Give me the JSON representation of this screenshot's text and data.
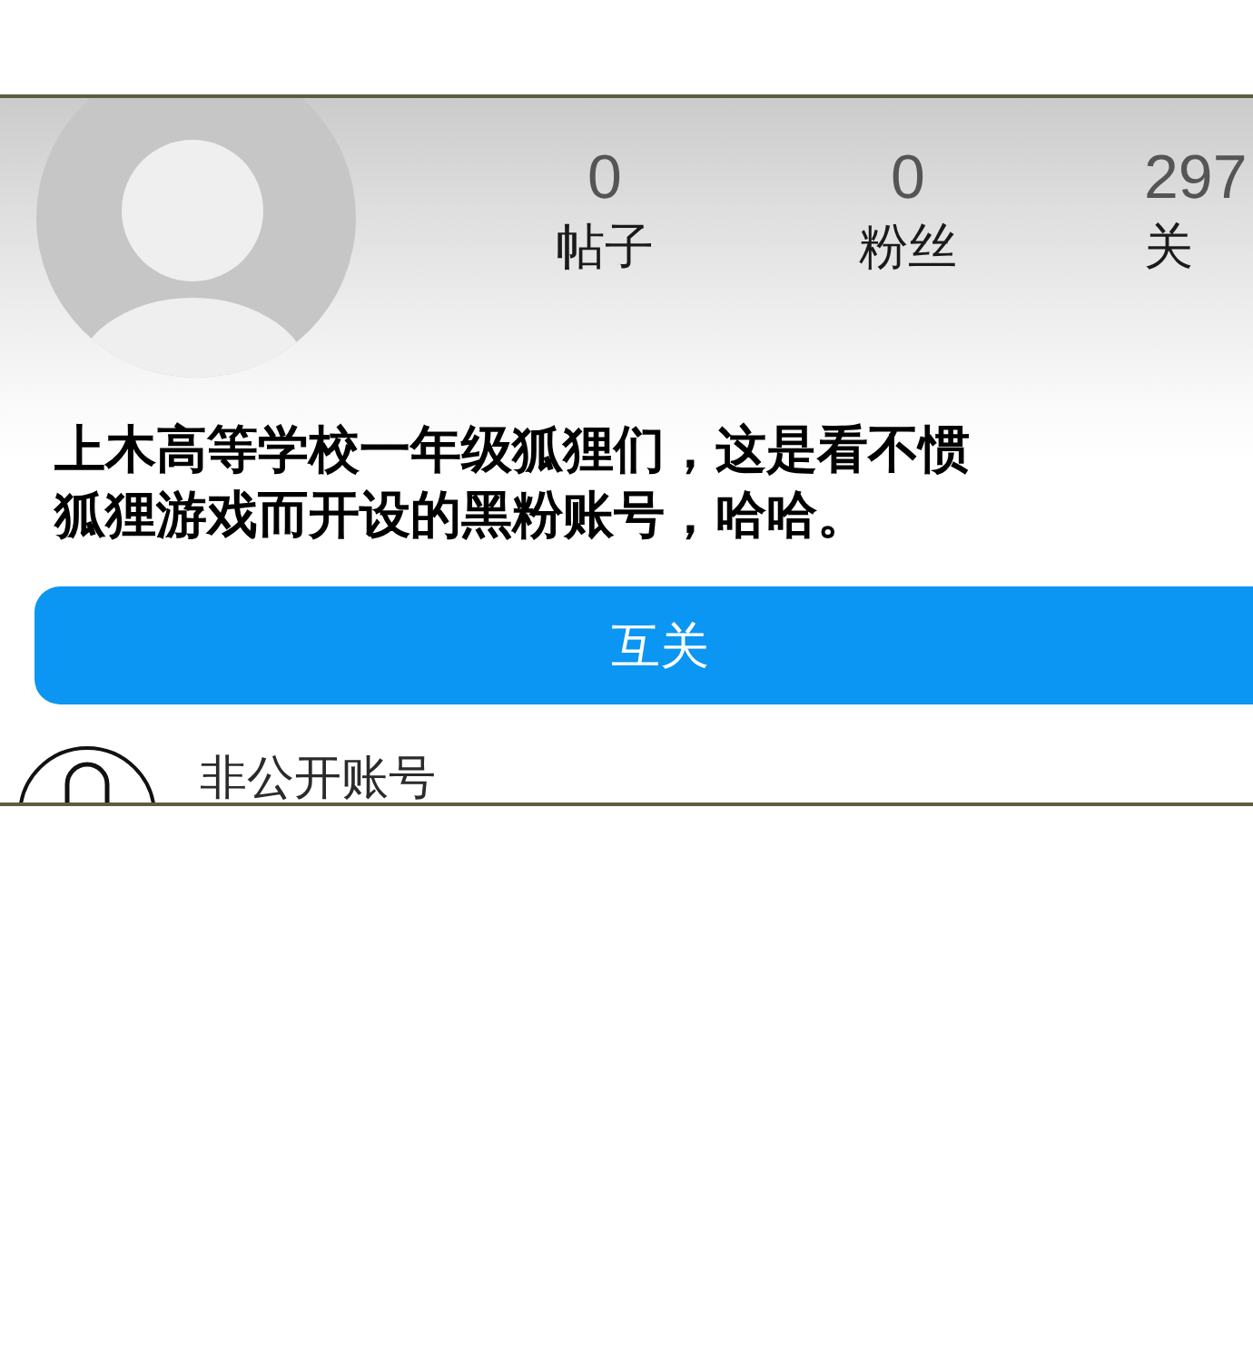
{
  "profile": {
    "stats": [
      {
        "count": "0",
        "label": "帖子"
      },
      {
        "count": "0",
        "label": "粉丝"
      },
      {
        "count": "297",
        "label": "关"
      }
    ],
    "bio": "上木高等学校一年级狐狸们，这是看不惯狐狸游戏而开设的黑粉账号，哈哈。"
  },
  "follow_button": {
    "label": "互关"
  },
  "privacy": {
    "label": "非公开账号"
  }
}
